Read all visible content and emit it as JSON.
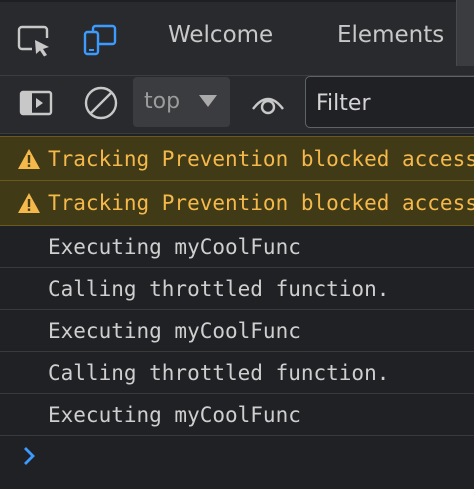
{
  "tabs": {
    "welcome": "Welcome",
    "elements": "Elements"
  },
  "icons": {
    "inspect": "inspect-element-icon",
    "device": "device-toolbar-icon",
    "sidebar": "show-sidebar-icon",
    "clear": "clear-console-icon",
    "eye": "live-expression-icon",
    "warning": "warning-icon",
    "prompt": "console-prompt-icon"
  },
  "toolbar": {
    "context": "top",
    "filter_placeholder": "Filter"
  },
  "console": {
    "messages": [
      {
        "level": "warning",
        "text": "Tracking Prevention blocked access to storage for"
      },
      {
        "level": "warning",
        "text": "Tracking Prevention blocked access to storage for"
      },
      {
        "level": "log",
        "text": "Executing myCoolFunc"
      },
      {
        "level": "log",
        "text": "Calling throttled function."
      },
      {
        "level": "log",
        "text": "Executing myCoolFunc"
      },
      {
        "level": "log",
        "text": "Calling throttled function."
      },
      {
        "level": "log",
        "text": "Executing myCoolFunc"
      }
    ]
  },
  "colors": {
    "background": "#202124",
    "toolbar": "#292a2d",
    "accent": "#3b9bff",
    "warning_bg": "#413a17",
    "warning_text": "#f5b94b"
  }
}
